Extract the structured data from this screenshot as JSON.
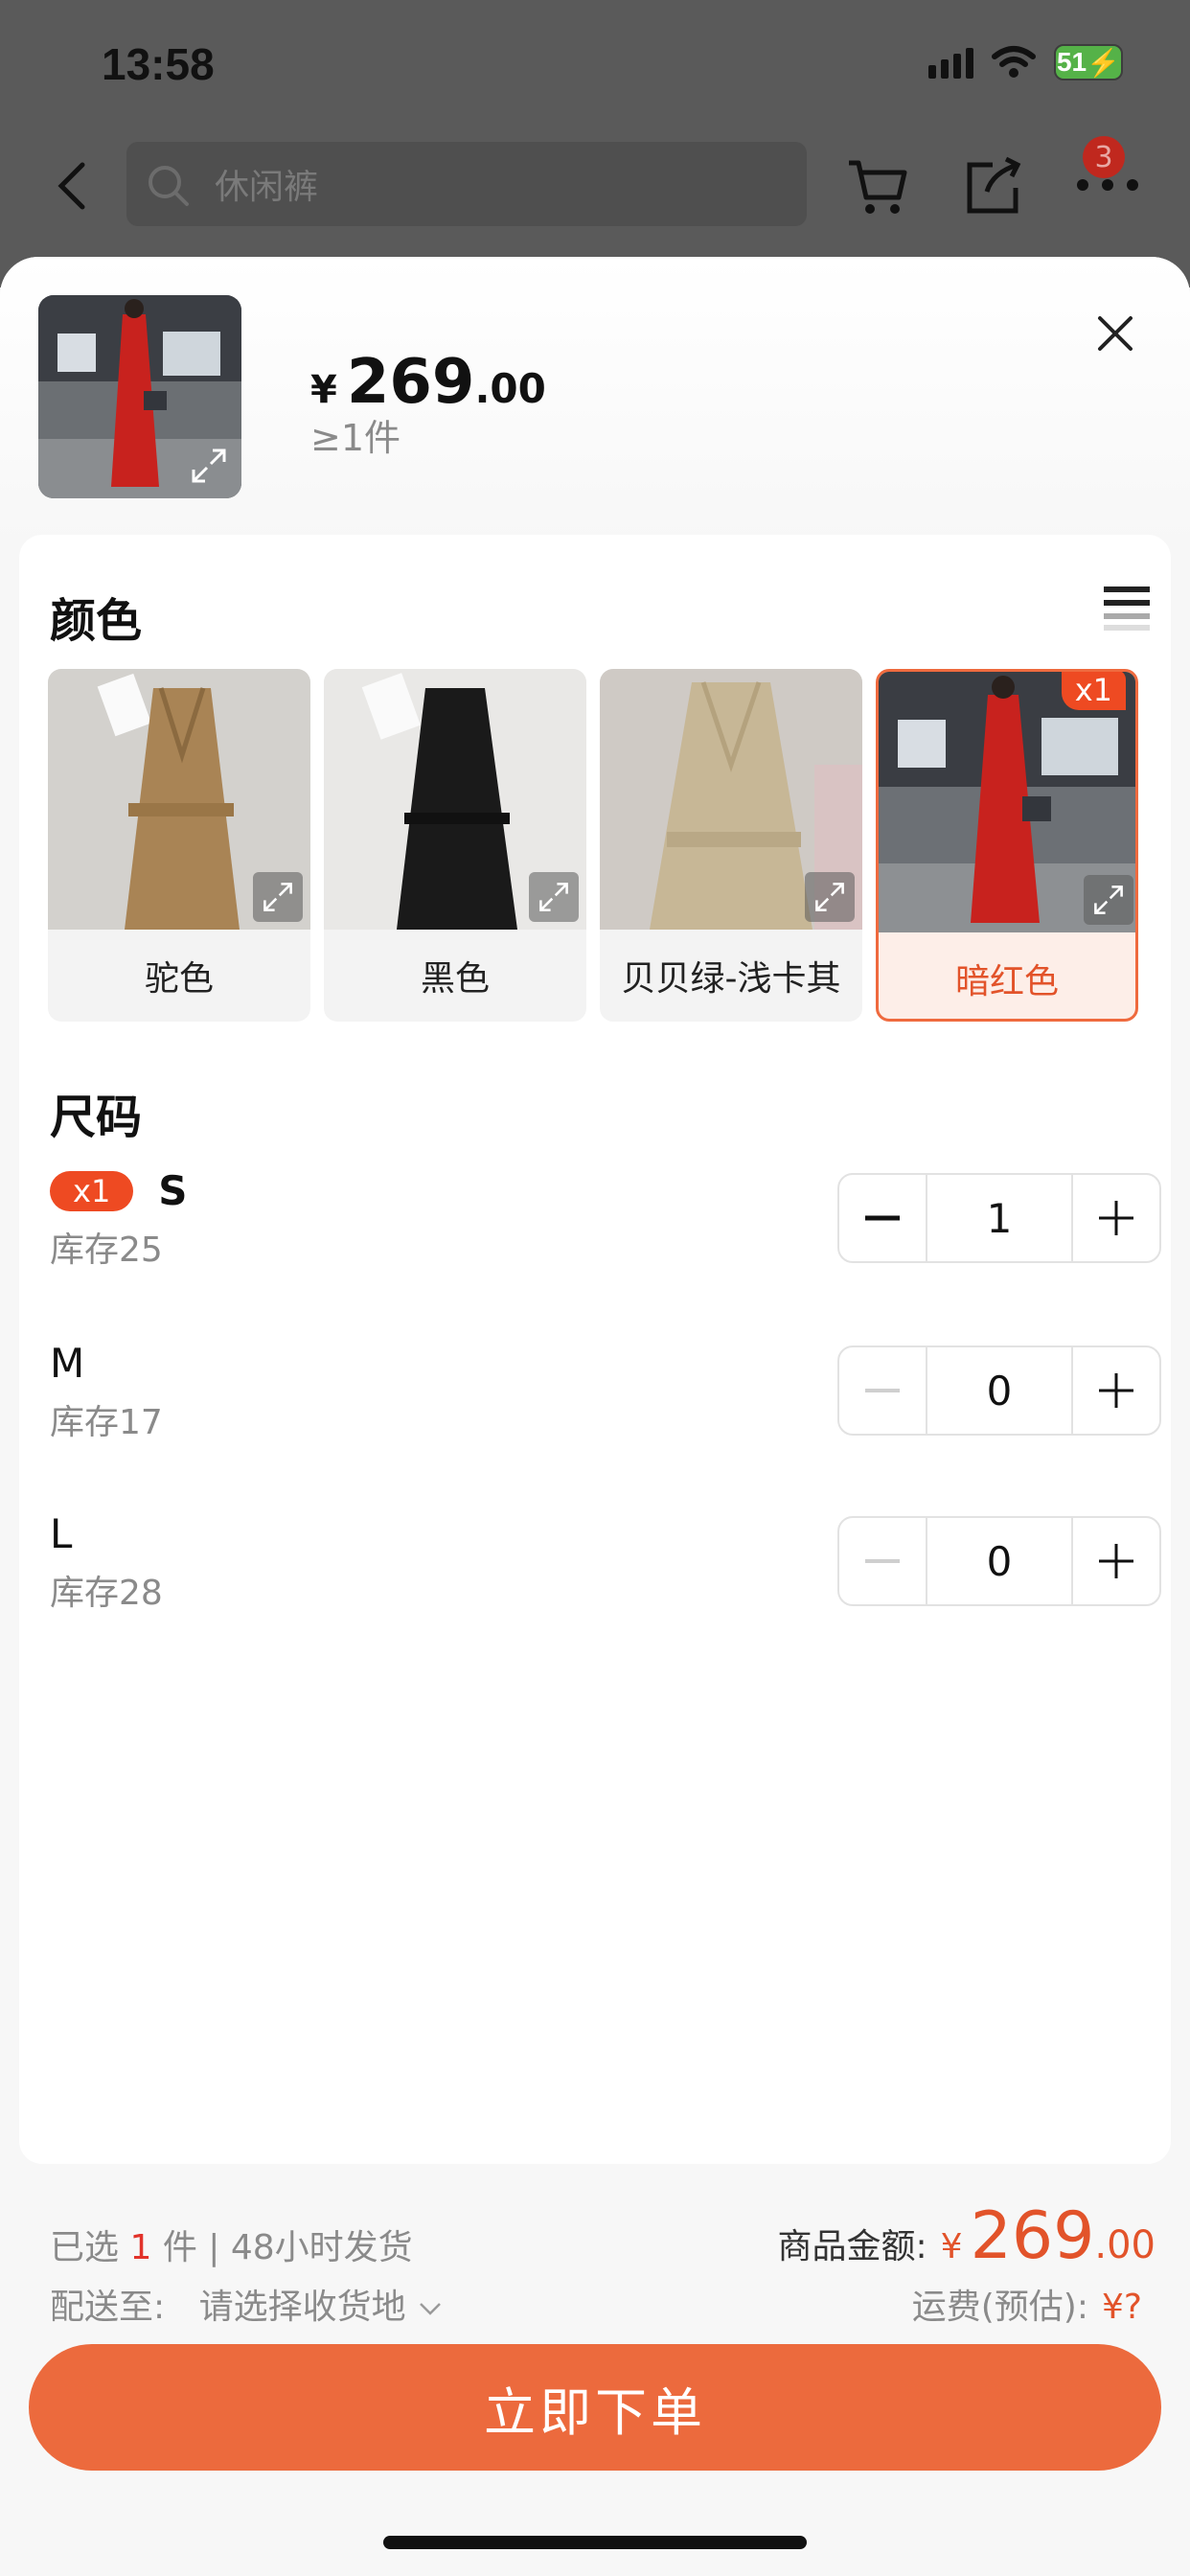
{
  "status_bar": {
    "time": "13:58",
    "battery": "51"
  },
  "nav": {
    "search_placeholder": "休闲裤",
    "cart_badge": "3"
  },
  "header": {
    "currency": "¥",
    "price_int": "269",
    "price_dec": ".00",
    "min_qty": "≥1件"
  },
  "colors": {
    "title": "颜色",
    "items": [
      {
        "label": "驼色"
      },
      {
        "label": "黑色"
      },
      {
        "label": "贝贝绿-浅卡其"
      },
      {
        "label": "暗红色",
        "badge": "x1"
      }
    ]
  },
  "sizes": {
    "title": "尺码",
    "items": [
      {
        "badge": "x1",
        "name": "S",
        "stock": "库存25",
        "qty": "1"
      },
      {
        "name": "M",
        "stock": "库存17",
        "qty": "0"
      },
      {
        "name": "L",
        "stock": "库存28",
        "qty": "0"
      }
    ]
  },
  "footer": {
    "selected_prefix": "已选",
    "selected_count": "1",
    "selected_suffix": "件 | 48小时发货",
    "ship_label": "配送至:",
    "ship_value": "请选择收货地",
    "amount_label": "商品金额:",
    "amount_currency": "¥",
    "amount_int": "269",
    "amount_dec": ".00",
    "freight_label": "运费(预估):",
    "freight_value": "¥?",
    "order_button": "立即下单"
  },
  "theme": {
    "accent": "#ec6a3d",
    "badge_red": "#ee4a22"
  }
}
